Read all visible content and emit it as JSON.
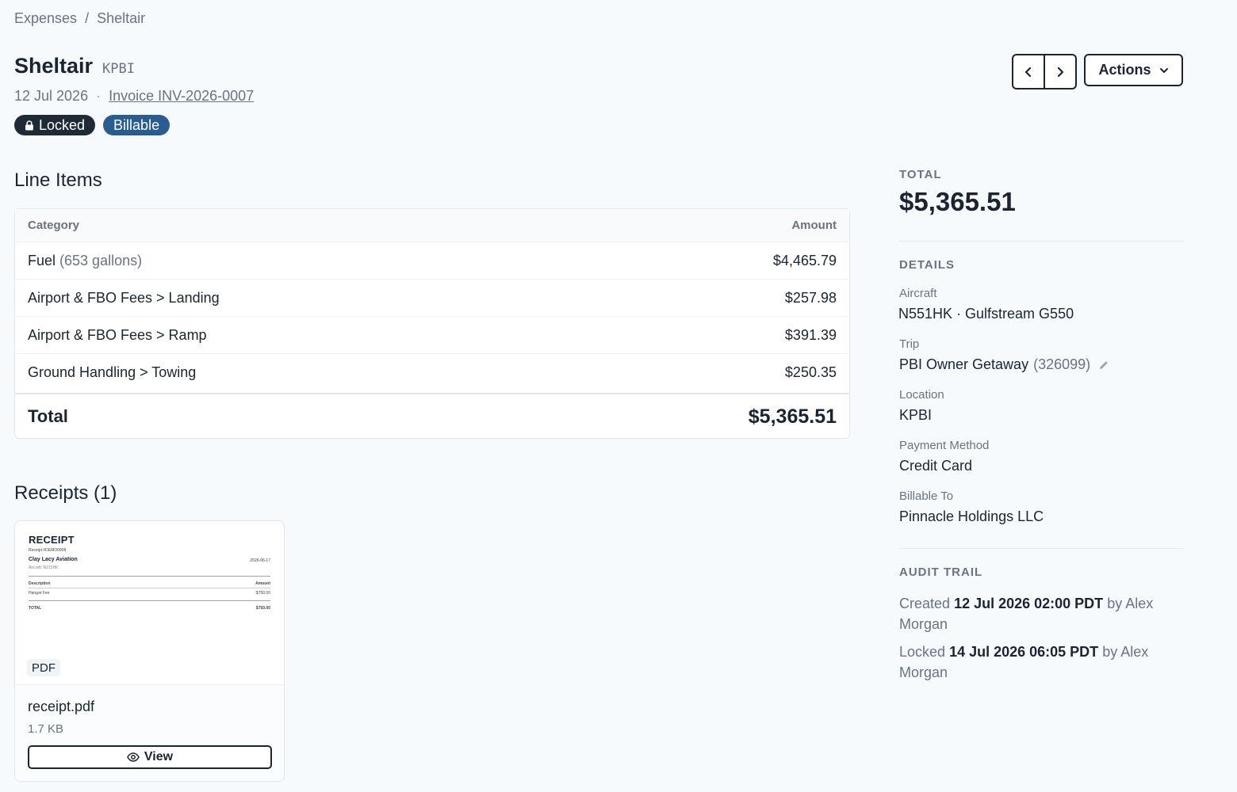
{
  "breadcrumb": {
    "parent": "Expenses",
    "sep": "/",
    "current": "Sheltair"
  },
  "header": {
    "title": "Sheltair",
    "location_code": "KPBI",
    "date": "12 Jul 2026",
    "dot": "·",
    "invoice_link": "Invoice INV-2026-0007",
    "badges": {
      "locked": "Locked",
      "billable": "Billable"
    }
  },
  "toolbar": {
    "prev_icon": "chevron-left-icon",
    "next_icon": "chevron-right-icon",
    "actions_label": "Actions"
  },
  "line_items": {
    "title": "Line Items",
    "columns": {
      "category": "Category",
      "amount": "Amount"
    },
    "rows": [
      {
        "category": "Fuel",
        "note": "(653 gallons)",
        "amount": "$4,465.79"
      },
      {
        "category": "Airport & FBO Fees > Landing",
        "note": "",
        "amount": "$257.98"
      },
      {
        "category": "Airport & FBO Fees > Ramp",
        "note": "",
        "amount": "$391.39"
      },
      {
        "category": "Ground Handling > Towing",
        "note": "",
        "amount": "$250.35"
      }
    ],
    "total_label": "Total",
    "total_value": "$5,365.51"
  },
  "receipts": {
    "title": "Receipts (1)",
    "items": [
      {
        "preview": {
          "heading": "RECEIPT",
          "receipt_no": "Receipt #DEMO0008",
          "vendor": "Clay Lacy Aviation",
          "date": "2026-06-17",
          "aircraft": "Aircraft: N215HK",
          "col_desc": "Description",
          "col_amount": "Amount",
          "line_desc": "Hangar Fee",
          "line_amount": "$750.00",
          "total_label": "TOTAL",
          "total_amount": "$750.00"
        },
        "type": "PDF",
        "file_name": "receipt.pdf",
        "file_size": "1.7 KB",
        "view_label": "View"
      }
    ]
  },
  "summary": {
    "total_caption": "TOTAL",
    "total_value": "$5,365.51",
    "details_caption": "DETAILS",
    "aircraft_label": "Aircraft",
    "aircraft_value": "N551HK · Gulfstream G550",
    "trip_label": "Trip",
    "trip_value": "PBI Owner Getaway",
    "trip_id": "(326099)",
    "location_label": "Location",
    "location_value": "KPBI",
    "payment_label": "Payment Method",
    "payment_value": "Credit Card",
    "billable_label": "Billable To",
    "billable_value": "Pinnacle Holdings LLC"
  },
  "audit": {
    "caption": "AUDIT TRAIL",
    "entries": [
      {
        "action": "Created",
        "when": "12 Jul 2026 02:00 PDT",
        "by": "by",
        "who": "Alex Morgan"
      },
      {
        "action": "Locked",
        "when": "14 Jul 2026 06:05 PDT",
        "by": "by",
        "who": "Alex Morgan"
      }
    ]
  },
  "colors": {
    "locked_badge": "#1f2a37",
    "billable_badge": "#2a5d8f",
    "page_bg": "#f7fafd"
  }
}
